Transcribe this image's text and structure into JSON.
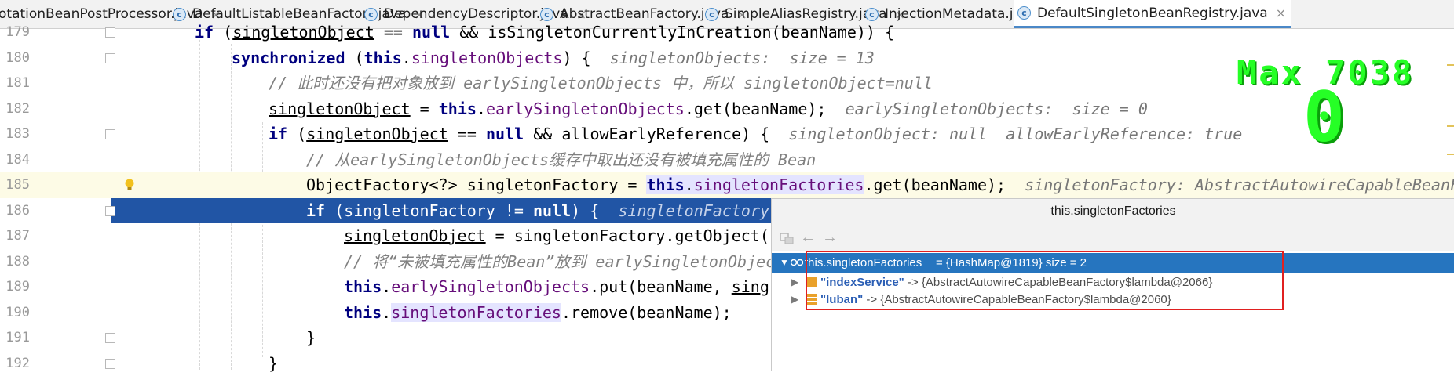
{
  "tabs": [
    {
      "label": "otationBeanPostProcessor.java",
      "icon": "class-icon",
      "active": false
    },
    {
      "label": "DefaultListableBeanFactory.java",
      "icon": "class-icon",
      "active": false
    },
    {
      "label": "DependencyDescriptor.java",
      "icon": "class-icon",
      "active": false
    },
    {
      "label": "AbstractBeanFactory.java",
      "icon": "class-icon",
      "active": false
    },
    {
      "label": "SimpleAliasRegistry.java",
      "icon": "class-icon",
      "active": false
    },
    {
      "label": "InjectionMetadata.java",
      "icon": "class-icon",
      "active": false
    },
    {
      "label": "DefaultSingletonBeanRegistry.java",
      "icon": "class-icon",
      "active": true
    }
  ],
  "close_glyph": "×",
  "lines": [
    {
      "num": "179"
    },
    {
      "num": "180"
    },
    {
      "num": "181"
    },
    {
      "num": "182"
    },
    {
      "num": "183"
    },
    {
      "num": "184"
    },
    {
      "num": "185"
    },
    {
      "num": "186"
    },
    {
      "num": "187"
    },
    {
      "num": "188"
    },
    {
      "num": "189"
    },
    {
      "num": "190"
    },
    {
      "num": "191"
    },
    {
      "num": "192"
    }
  ],
  "code": {
    "l179": {
      "kw_if": "if",
      "p1": " (",
      "v1": "singletonObject",
      "p2": " == ",
      "kw_null": "null",
      "p3": " && isSingletonCurrentlyInCreation(beanName)) {"
    },
    "l180": {
      "kw": "synchronized",
      "p1": " (",
      "kw_this": "this",
      "dot": ".",
      "fld": "singletonObjects",
      "p2": ") {",
      "hint": "singletonObjects:  size = 13"
    },
    "l181": {
      "comment": "// 此时还没有把对象放到 earlySingletonObjects 中，所以 singletonObject=null"
    },
    "l182": {
      "v1": "singletonObject",
      "p1": " = ",
      "kw_this": "this",
      "dot": ".",
      "fld": "earlySingletonObjects",
      "p2": ".get(beanName);",
      "hint": "earlySingletonObjects:  size = 0"
    },
    "l183": {
      "kw_if": "if",
      "p1": " (",
      "v1": "singletonObject",
      "p2": " == ",
      "kw_null": "null",
      "p3": " && allowEarlyReference) {",
      "hint": "singletonObject: null  allowEarlyReference: true"
    },
    "l184": {
      "comment": "// 从earlySingletonObjects缓存中取出还没有被填充属性的 Bean"
    },
    "l185": {
      "p1": "ObjectFactory<?> singletonFactory = ",
      "kw_this": "this",
      "dot": ".",
      "fld": "singletonFactories",
      "p2": ".get(beanName);",
      "hint": "singletonFactory: AbstractAutowireCapableBeanF"
    },
    "l186": {
      "kw_if": "if",
      "p1": " (singletonFactory != ",
      "kw_null": "null",
      "p2": ") {",
      "hint": "singletonFactory"
    },
    "l187": {
      "v1": "singletonObject",
      "p1": " = singletonFactory.getObject("
    },
    "l188": {
      "comment": "// 将“未被填充属性的Bean”放到 earlySingletonObjec"
    },
    "l189": {
      "kw_this": "this",
      "dot": ".",
      "fld": "earlySingletonObjects",
      "p1": ".put(beanName, ",
      "v1": "sing"
    },
    "l190": {
      "kw_this": "this",
      "dot": ".",
      "fld": "singletonFactories",
      "p1": ".remove(beanName);"
    },
    "l191": {
      "p1": "}"
    },
    "l192": {
      "p1": "}"
    }
  },
  "hud": {
    "label": "Max 7038",
    "value": "0"
  },
  "popup": {
    "title": "this.singletonFactories",
    "toolbar": [
      "watch-icon",
      "back-arrow-icon",
      "forward-arrow-icon"
    ],
    "root": {
      "name": "this.singletonFactories",
      "value": " = {HashMap@1819}  size = 2"
    },
    "children": [
      {
        "key": "\"indexService\"",
        "arrow": " -> ",
        "value": "{AbstractAutowireCapableBeanFactory$lambda@2066}"
      },
      {
        "key": "\"luban\"",
        "arrow": " -> ",
        "value": "{AbstractAutowireCapableBeanFactory$lambda@2060}"
      }
    ]
  },
  "colors": {
    "exec_line": "#2155a5",
    "selected_row": "#2675bf",
    "highlight_box": "#e02020",
    "hud": "#26ff26"
  }
}
